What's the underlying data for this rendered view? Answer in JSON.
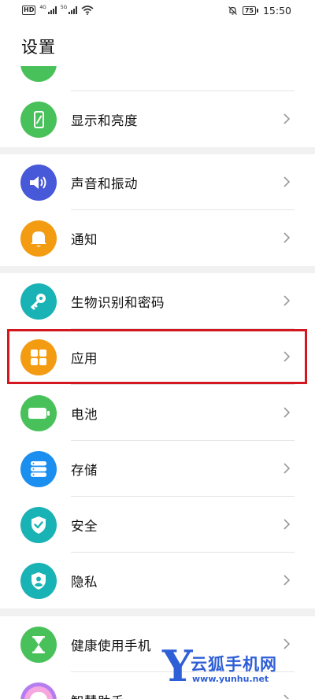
{
  "status_bar": {
    "hd": "HD",
    "net1": "4G",
    "net2": "5G",
    "battery": "75",
    "time": "15:50"
  },
  "header": {
    "title": "设置"
  },
  "groups": [
    {
      "items": [
        {
          "label": "",
          "icon": "partially-hidden-icon",
          "color": "#49c15a"
        }
      ]
    },
    {
      "items": [
        {
          "label": "显示和亮度",
          "icon": "phone-brightness-icon",
          "color": "#49c15a"
        }
      ]
    },
    {
      "items": [
        {
          "label": "声音和振动",
          "icon": "speaker-icon",
          "color": "#4758d8"
        },
        {
          "label": "通知",
          "icon": "bell-icon",
          "color": "#f39c12"
        }
      ]
    },
    {
      "items": [
        {
          "label": "生物识别和密码",
          "icon": "key-icon",
          "color": "#19b2b5"
        },
        {
          "label": "应用",
          "icon": "apps-grid-icon",
          "color": "#f39c12"
        },
        {
          "label": "电池",
          "icon": "battery-icon",
          "color": "#49c15a"
        },
        {
          "label": "存储",
          "icon": "storage-icon",
          "color": "#1a8ff0"
        },
        {
          "label": "安全",
          "icon": "shield-check-icon",
          "color": "#19b2b5"
        },
        {
          "label": "隐私",
          "icon": "privacy-shield-icon",
          "color": "#19b2b5"
        }
      ]
    },
    {
      "items": [
        {
          "label": "健康使用手机",
          "icon": "hourglass-icon",
          "color": "#49c15a"
        },
        {
          "label": "智慧助手",
          "icon": "assistant-icon",
          "color": "#e860c0"
        }
      ]
    }
  ],
  "watermark": {
    "letter": "Y",
    "title": "云狐手机网",
    "url": "www.yunhu.net"
  }
}
